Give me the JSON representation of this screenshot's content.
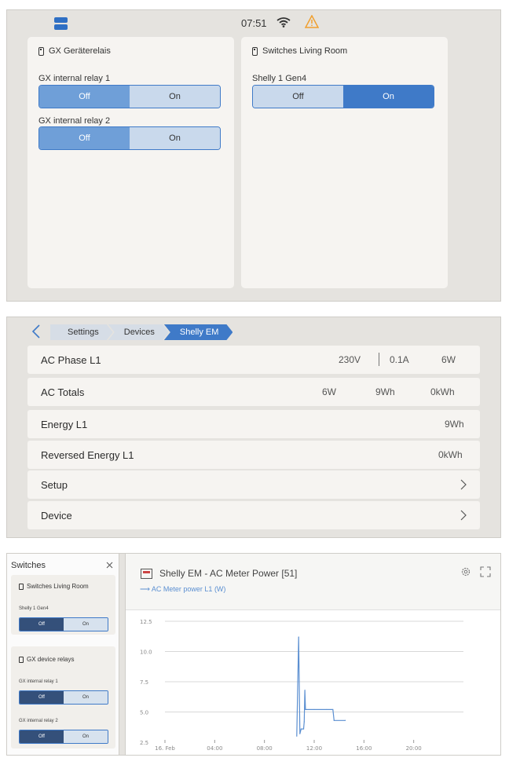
{
  "status": {
    "time": "07:51"
  },
  "panel1": {
    "card1": {
      "title": "GX Geräterelais",
      "relays": [
        {
          "label": "GX internal relay 1",
          "off": "Off",
          "on": "On",
          "state": "Off"
        },
        {
          "label": "GX internal relay 2",
          "off": "Off",
          "on": "On",
          "state": "Off"
        }
      ]
    },
    "card2": {
      "title": "Switches Living Room",
      "relays": [
        {
          "label": "Shelly 1 Gen4",
          "off": "Off",
          "on": "On",
          "state": "On"
        }
      ]
    }
  },
  "panel2": {
    "breadcrumbs": [
      "Settings",
      "Devices",
      "Shelly EM"
    ],
    "rows": [
      {
        "label": "AC Phase L1",
        "values": [
          "230V",
          "0.1A",
          "6W"
        ]
      },
      {
        "label": "AC Totals",
        "values": [
          "6W",
          "9Wh",
          "0kWh"
        ]
      },
      {
        "label": "Energy L1",
        "values": [
          "9Wh"
        ]
      },
      {
        "label": "Reversed Energy L1",
        "values": [
          "0kWh"
        ]
      },
      {
        "label": "Setup",
        "values": []
      },
      {
        "label": "Device",
        "values": []
      }
    ]
  },
  "panel3": {
    "switches": {
      "title": "Switches",
      "card1": {
        "title": "Switches Living Room",
        "relays": [
          {
            "label": "Shelly 1 Gen4",
            "off": "Off",
            "on": "On"
          }
        ]
      },
      "card2": {
        "title": "GX device relays",
        "relays": [
          {
            "label": "GX internal relay 1",
            "off": "Off",
            "on": "On"
          },
          {
            "label": "GX internal relay 2",
            "off": "Off",
            "on": "On"
          }
        ]
      }
    },
    "chart_title": "Shelly EM - AC Meter Power [51]",
    "legend": "AC Meter power L1 (W)"
  },
  "chart_data": {
    "type": "line",
    "title": "Shelly EM - AC Meter Power [51]",
    "series": [
      {
        "name": "AC Meter power L1 (W)",
        "color": "#5b8fd1",
        "points": [
          [
            10.6,
            3.0
          ],
          [
            10.75,
            11.2
          ],
          [
            10.85,
            3.2
          ],
          [
            10.95,
            3.6
          ],
          [
            11.0,
            3.6
          ],
          [
            11.15,
            3.6
          ],
          [
            11.2,
            4.2
          ],
          [
            11.25,
            6.8
          ],
          [
            11.3,
            5.2
          ],
          [
            12.0,
            5.2
          ],
          [
            13.0,
            5.2
          ],
          [
            13.5,
            5.2
          ],
          [
            13.6,
            4.3
          ],
          [
            14.5,
            4.3
          ]
        ]
      }
    ],
    "xticks": [
      {
        "x": 0,
        "label": "16. Feb"
      },
      {
        "x": 4,
        "label": "04:00"
      },
      {
        "x": 8,
        "label": "08:00"
      },
      {
        "x": 12,
        "label": "12:00"
      },
      {
        "x": 16,
        "label": "16:00"
      },
      {
        "x": 20,
        "label": "20:00"
      }
    ],
    "yticks": [
      2.5,
      5.0,
      7.5,
      10.0,
      12.5
    ],
    "xlim": [
      0,
      24
    ],
    "ylim": [
      2.5,
      12.5
    ],
    "grid": true
  }
}
